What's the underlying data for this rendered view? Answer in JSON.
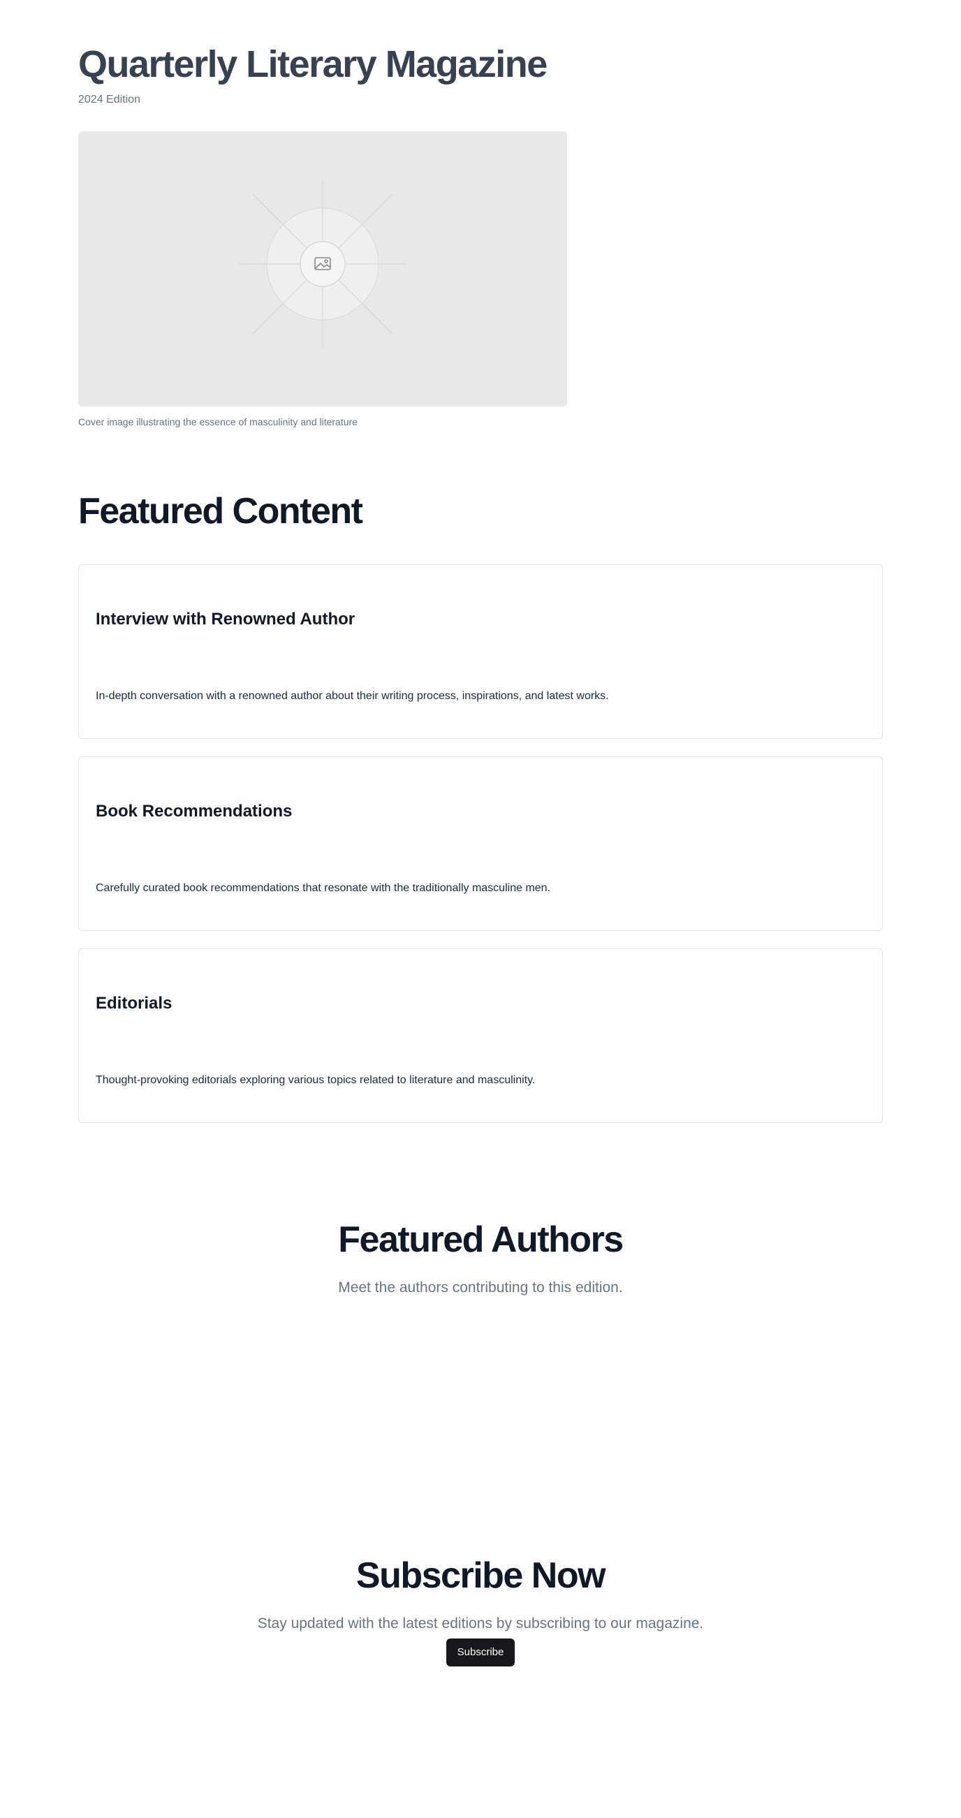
{
  "header": {
    "title": "Quarterly Literary Magazine",
    "edition": "2024 Edition"
  },
  "cover": {
    "icon": "image-icon",
    "caption": "Cover image illustrating the essence of masculinity and literature"
  },
  "featured_content": {
    "title": "Featured Content",
    "cards": [
      {
        "title": "Interview with Renowned Author",
        "description": "In-depth conversation with a renowned author about their writing process, inspirations, and latest works."
      },
      {
        "title": "Book Recommendations",
        "description": "Carefully curated book recommendations that resonate with the traditionally masculine men."
      },
      {
        "title": "Editorials",
        "description": "Thought-provoking editorials exploring various topics related to literature and masculinity."
      }
    ]
  },
  "featured_authors": {
    "title": "Featured Authors",
    "subtitle": "Meet the authors contributing to this edition."
  },
  "subscribe": {
    "title": "Subscribe Now",
    "subtitle": "Stay updated with the latest editions by subscribing to our magazine.",
    "button_label": "Subscribe"
  },
  "colors": {
    "title_header": "#374151",
    "title_section": "#111827",
    "muted_text": "#6b7280",
    "card_border": "#e5e7eb",
    "cover_bg": "#e8e8e8",
    "button_bg": "#18181b"
  }
}
